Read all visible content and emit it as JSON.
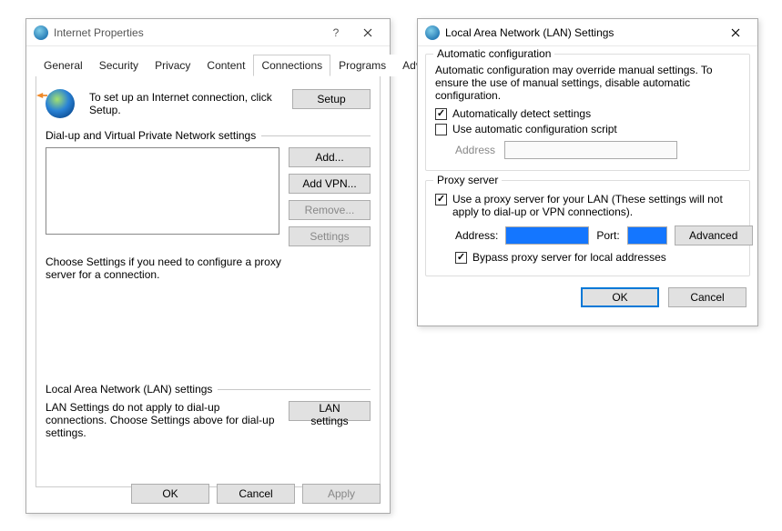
{
  "left": {
    "title": "Internet Properties",
    "tabs": [
      "General",
      "Security",
      "Privacy",
      "Content",
      "Connections",
      "Programs",
      "Advanced"
    ],
    "active_tab": "Connections",
    "setup_text": "To set up an Internet connection, click Setup.",
    "btn_setup": "Setup",
    "group_dialup": "Dial-up and Virtual Private Network settings",
    "btn_add": "Add...",
    "btn_addvpn": "Add VPN...",
    "btn_remove": "Remove...",
    "btn_settings": "Settings",
    "choose_text": "Choose Settings if you need to configure a proxy server for a connection.",
    "group_lan": "Local Area Network (LAN) settings",
    "lan_text": "LAN Settings do not apply to dial-up connections. Choose Settings above for dial-up settings.",
    "btn_lan": "LAN settings",
    "btn_ok": "OK",
    "btn_cancel": "Cancel",
    "btn_apply": "Apply"
  },
  "right": {
    "title": "Local Area Network (LAN) Settings",
    "auto": {
      "legend": "Automatic configuration",
      "desc": "Automatic configuration may override manual settings.  To ensure the use of manual settings, disable automatic configuration.",
      "chk_detect": "Automatically detect settings",
      "chk_script": "Use automatic configuration script",
      "lbl_address": "Address"
    },
    "proxy": {
      "legend": "Proxy server",
      "chk_use": "Use a proxy server for your LAN (These settings will not apply to dial-up or VPN connections).",
      "lbl_address": "Address:",
      "lbl_port": "Port:",
      "btn_adv": "Advanced",
      "chk_bypass": "Bypass proxy server for local addresses"
    },
    "btn_ok": "OK",
    "btn_cancel": "Cancel"
  }
}
